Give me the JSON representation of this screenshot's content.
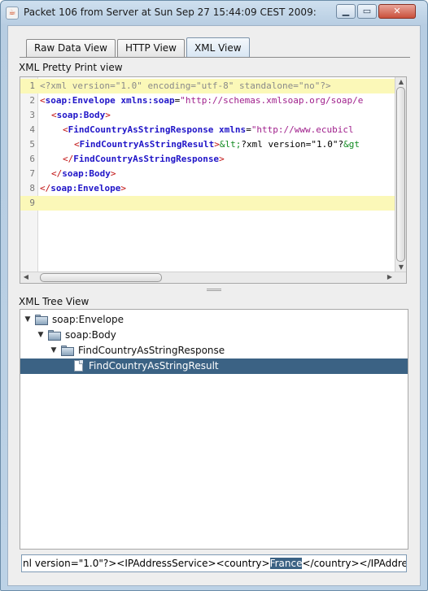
{
  "window": {
    "title": "Packet 106 from Server at Sun Sep 27 15:44:09 CEST 2009:",
    "app_icon": "java-cup-icon",
    "controls": {
      "minimize": "▁",
      "maximize": "▭",
      "close": "✕"
    }
  },
  "tabs": [
    {
      "label": "Raw Data View",
      "active": false
    },
    {
      "label": "HTTP View",
      "active": false
    },
    {
      "label": "XML View",
      "active": true
    }
  ],
  "pretty_print": {
    "label": "XML Pretty Print view",
    "lines": [
      {
        "n": "1",
        "highlighted": true
      },
      {
        "n": "2"
      },
      {
        "n": "3"
      },
      {
        "n": "4"
      },
      {
        "n": "5"
      },
      {
        "n": "6"
      },
      {
        "n": "7"
      },
      {
        "n": "8"
      },
      {
        "n": "9",
        "highlighted": true
      }
    ],
    "tokens": {
      "l1": "<?xml version=\"1.0\" encoding=\"utf-8\" standalone=\"no\"?>",
      "l2_open": "<",
      "l2_tag": "soap:Envelope",
      "l2_attr": " xmlns:soap",
      "l2_eq": "=",
      "l2_val": "\"http://schemas.xmlsoap.org/soap/e",
      "l3_open": "<",
      "l3_tag": "soap:Body",
      "l3_close": ">",
      "l4_open": "<",
      "l4_tag": "FindCountryAsStringResponse",
      "l4_attr": " xmlns",
      "l4_eq": "=",
      "l4_val": "\"http://www.ecubicl",
      "l5_open": "<",
      "l5_tag": "FindCountryAsStringResult",
      "l5_close": ">",
      "l5_ent1": "&lt;",
      "l5_text": "?xml version=\"1.0\"?",
      "l5_ent2": "&gt",
      "l6_open": "</",
      "l6_tag": "FindCountryAsStringResponse",
      "l6_close": ">",
      "l7_open": "</",
      "l7_tag": "soap:Body",
      "l7_close": ">",
      "l8_open": "</",
      "l8_tag": "soap:Envelope",
      "l8_close": ">"
    }
  },
  "tree": {
    "label": "XML Tree View",
    "nodes": [
      {
        "label": "soap:Envelope",
        "type": "folder",
        "expanded": true,
        "depth": 0
      },
      {
        "label": "soap:Body",
        "type": "folder",
        "expanded": true,
        "depth": 1
      },
      {
        "label": "FindCountryAsStringResponse",
        "type": "folder",
        "expanded": true,
        "depth": 2
      },
      {
        "label": "FindCountryAsStringResult",
        "type": "leaf",
        "selected": true,
        "depth": 3
      }
    ]
  },
  "value_field": {
    "before": "nl version=\"1.0\"?><IPAddressService><country>",
    "selected": "France",
    "after": "</country></IPAddressService>"
  }
}
